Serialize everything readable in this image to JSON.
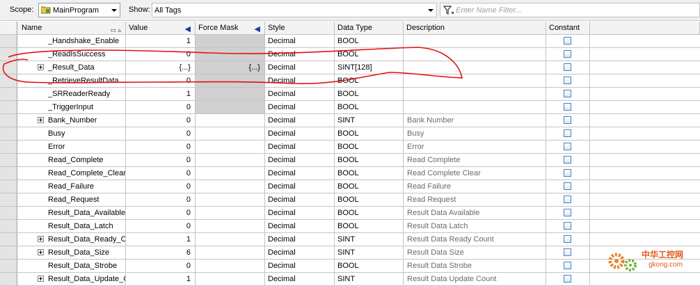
{
  "toolbar": {
    "scope_label": "Scope:",
    "scope_value": "MainProgram",
    "show_label": "Show:",
    "show_value": "All Tags",
    "filter_placeholder": "Enter Name Filter..."
  },
  "columns": {
    "name": "Name",
    "value": "Value",
    "force_mask": "Force Mask",
    "style": "Style",
    "data_type": "Data Type",
    "description": "Description",
    "constant": "Constant"
  },
  "rows": [
    {
      "name": "_Handshake_Enable",
      "value": "1",
      "force": "",
      "style": "Decimal",
      "type": "BOOL",
      "desc": "",
      "expand": false,
      "grey": true
    },
    {
      "name": "_ReadIsSuccess",
      "value": "0",
      "force": "",
      "style": "Decimal",
      "type": "BOOL",
      "desc": "",
      "expand": false,
      "grey": true
    },
    {
      "name": "_Result_Data",
      "value": "{...}",
      "force": "{...}",
      "style": "Decimal",
      "type": "SINT[128]",
      "desc": "",
      "expand": true,
      "grey": true
    },
    {
      "name": "_RetrieveResultData",
      "value": "0",
      "force": "",
      "style": "Decimal",
      "type": "BOOL",
      "desc": "",
      "expand": false,
      "grey": true
    },
    {
      "name": "_SRReaderReady",
      "value": "1",
      "force": "",
      "style": "Decimal",
      "type": "BOOL",
      "desc": "",
      "expand": false,
      "grey": true
    },
    {
      "name": "_TriggerInput",
      "value": "0",
      "force": "",
      "style": "Decimal",
      "type": "BOOL",
      "desc": "",
      "expand": false,
      "grey": true
    },
    {
      "name": "Bank_Number",
      "value": "0",
      "force": "",
      "style": "Decimal",
      "type": "SINT",
      "desc": "Bank Number",
      "expand": true,
      "grey": false
    },
    {
      "name": "Busy",
      "value": "0",
      "force": "",
      "style": "Decimal",
      "type": "BOOL",
      "desc": "Busy",
      "expand": false,
      "grey": false
    },
    {
      "name": "Error",
      "value": "0",
      "force": "",
      "style": "Decimal",
      "type": "BOOL",
      "desc": "Error",
      "expand": false,
      "grey": false
    },
    {
      "name": "Read_Complete",
      "value": "0",
      "force": "",
      "style": "Decimal",
      "type": "BOOL",
      "desc": "Read Complete",
      "expand": false,
      "grey": false
    },
    {
      "name": "Read_Complete_Clear",
      "value": "0",
      "force": "",
      "style": "Decimal",
      "type": "BOOL",
      "desc": "Read Complete Clear",
      "expand": false,
      "grey": false
    },
    {
      "name": "Read_Failure",
      "value": "0",
      "force": "",
      "style": "Decimal",
      "type": "BOOL",
      "desc": "Read Failure",
      "expand": false,
      "grey": false
    },
    {
      "name": "Read_Request",
      "value": "0",
      "force": "",
      "style": "Decimal",
      "type": "BOOL",
      "desc": "Read Request",
      "expand": false,
      "grey": false
    },
    {
      "name": "Result_Data_Available",
      "value": "0",
      "force": "",
      "style": "Decimal",
      "type": "BOOL",
      "desc": "Result Data Available",
      "expand": false,
      "grey": false
    },
    {
      "name": "Result_Data_Latch",
      "value": "0",
      "force": "",
      "style": "Decimal",
      "type": "BOOL",
      "desc": "Result Data Latch",
      "expand": false,
      "grey": false
    },
    {
      "name": "Result_Data_Ready_Count",
      "value": "1",
      "force": "",
      "style": "Decimal",
      "type": "SINT",
      "desc": "Result Data Ready Count",
      "expand": true,
      "grey": false
    },
    {
      "name": "Result_Data_Size",
      "value": "6",
      "force": "",
      "style": "Decimal",
      "type": "SINT",
      "desc": "Result Data Size",
      "expand": true,
      "grey": false
    },
    {
      "name": "Result_Data_Strobe",
      "value": "0",
      "force": "",
      "style": "Decimal",
      "type": "BOOL",
      "desc": "Result Data Strobe",
      "expand": false,
      "grey": false
    },
    {
      "name": "Result_Data_Update_Count",
      "value": "1",
      "force": "",
      "style": "Decimal",
      "type": "SINT",
      "desc": "Result Data Update Count",
      "expand": true,
      "grey": false
    }
  ],
  "watermark": {
    "text": "中华工控网",
    "sub": "gkong.com"
  },
  "colors": {
    "annotation_stroke": "#e01010",
    "checkbox_border": "#4a7ebb",
    "watermark": "#e05a1e"
  }
}
